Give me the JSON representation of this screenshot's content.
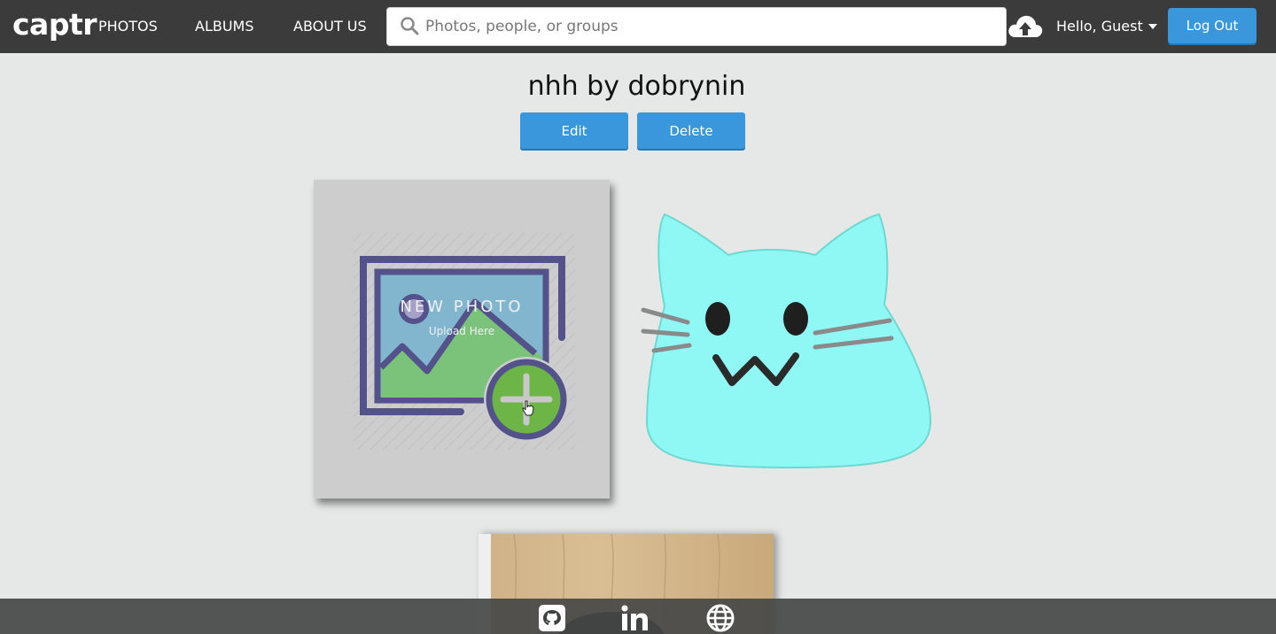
{
  "navbar": {
    "logo": "captr",
    "links": [
      "PHOTOS",
      "ALBUMS",
      "ABOUT US"
    ],
    "search_placeholder": "Photos, people, or groups",
    "greeting": "Hello, Guest",
    "logout_label": "Log Out"
  },
  "album": {
    "title": "nhh by dobrynin",
    "edit_label": "Edit",
    "delete_label": "Delete"
  },
  "new_photo": {
    "label": "NEW PHOTO",
    "sub_label": "Upload Here"
  },
  "colors": {
    "navbar_bg": "#3b3b3b",
    "button_blue": "#3a97db",
    "cat_cyan": "#8ff8f5",
    "page_bg": "#e6e8e8"
  },
  "icons": {
    "search": "search-icon",
    "upload": "cloud-upload-icon",
    "footer": [
      "github-icon",
      "linkedin-icon",
      "globe-icon"
    ]
  }
}
